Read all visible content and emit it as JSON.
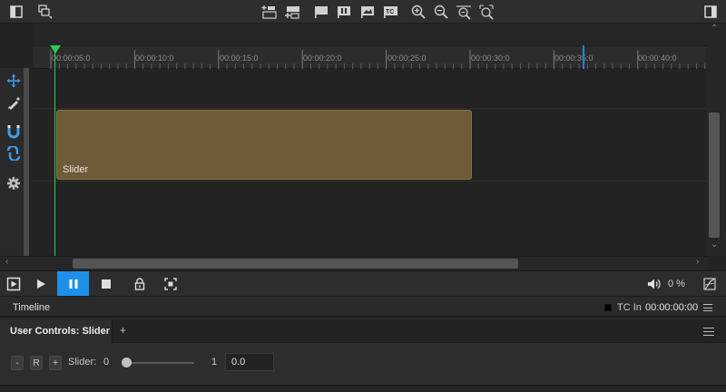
{
  "ruler": {
    "labels": [
      "00:00:05:0",
      "00:00:10:0",
      "00:00:15:0",
      "00:00:20:0",
      "00:00:25:0",
      "00:00:30:0",
      "00:00:35:0",
      "00:00:40:0"
    ]
  },
  "track": {
    "clip_label": "Slider",
    "clip_color": "#6e5b3a"
  },
  "transport": {
    "volume": "0 %",
    "active_color": "#1e90ea"
  },
  "panel": {
    "title": "Timeline",
    "tc_label": "TC In",
    "tc_value": "00:00:00:00"
  },
  "user_controls": {
    "tab_label": "User Controls: Slider",
    "add_tab": "+",
    "minus_label": "-",
    "reset_label": "R",
    "plus_label": "+",
    "slider_label": "Slider:",
    "slider_min": "0",
    "slider_max": "1",
    "slider_value_fraction": 0,
    "value": "0.0"
  },
  "colors": {
    "playhead": "#2ecc55",
    "marker": "#2a7fd8",
    "accent_tool": "#3a9ee8"
  },
  "icons": {
    "toolbar": [
      "panel-left-icon",
      "layers-icon",
      "insert-above-icon",
      "insert-below-icon",
      "flag-icon",
      "pause-marker-icon",
      "image-marker-icon",
      "tc-marker-icon",
      "zoom-in-icon",
      "zoom-out-icon",
      "zoom-fit-icon",
      "zoom-reset-icon",
      "panel-right-icon"
    ],
    "tools": [
      "move-icon",
      "pen-icon",
      "magnet-icon",
      "magnet-link-icon",
      "gear-icon"
    ]
  }
}
